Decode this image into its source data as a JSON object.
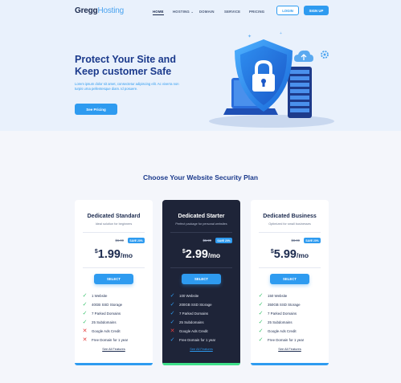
{
  "brand": {
    "bold": "Gregg",
    "light": "Hosting"
  },
  "nav": {
    "home": "HOME",
    "hosting": "HOSTING",
    "hosting_caret": "⌄",
    "domain": "DOMAIN",
    "service": "SERVICE",
    "pricing": "PRICING"
  },
  "auth": {
    "login": "LOGIN",
    "signup": "SIGN UP"
  },
  "hero": {
    "title": "Protect Your Site and Keep customer Safe",
    "text": "Lorem ipsum dolor sit amet, consectetur adipiscing elit. Ac viverra non turpis urna pellentesque diam. Id posuere.",
    "button": "See Pricing"
  },
  "plans_title": "Choose Your Website Security Plan",
  "plans": [
    {
      "name": "Dedicated Standard",
      "tagline": "Ideal solution for beginners",
      "old_price": "$6.99",
      "save": "SAVE 20%",
      "currency": "$",
      "price": "1.99",
      "period": "/mo",
      "select": "SELECT",
      "features": [
        {
          "text": "1 Website",
          "included": true
        },
        {
          "text": "40GB SSD Storage",
          "included": true
        },
        {
          "text": "7 Parked Domains",
          "included": true
        },
        {
          "text": "25 Subdomains",
          "included": true
        },
        {
          "text": "Google Ads Credit",
          "included": false
        },
        {
          "text": "Free Domain for 1 year",
          "included": false
        }
      ],
      "see_all": "See All Features"
    },
    {
      "name": "Dedicated Starter",
      "tagline": "Perfect package for personal websites",
      "old_price": "$6.99",
      "save": "SAVE 20%",
      "currency": "$",
      "price": "2.99",
      "period": "/mo",
      "select": "SELECT",
      "features": [
        {
          "text": "100 Website",
          "included": true
        },
        {
          "text": "200GB SSD Storage",
          "included": true
        },
        {
          "text": "7 Parked Domains",
          "included": true
        },
        {
          "text": "25 Subdomains",
          "included": true
        },
        {
          "text": "Google Ads Credit",
          "included": false
        },
        {
          "text": "Free Domain for 1 year",
          "included": true
        }
      ],
      "see_all": "See All Features"
    },
    {
      "name": "Dedicated Business",
      "tagline": "Optimized for small businesses",
      "old_price": "$8.99",
      "save": "SAVE 20%",
      "currency": "$",
      "price": "5.99",
      "period": "/mo",
      "select": "SELECT",
      "features": [
        {
          "text": "150 Website",
          "included": true
        },
        {
          "text": "350GB SSD Storage",
          "included": true
        },
        {
          "text": "7 Parked Domains",
          "included": true
        },
        {
          "text": "25 Subdomains",
          "included": true
        },
        {
          "text": "Google Ads Credit",
          "included": true
        },
        {
          "text": "Free Domain for 1 year",
          "included": true
        }
      ],
      "see_all": "See All Features"
    }
  ],
  "icons": {
    "check": "check-icon",
    "cross": "cross-icon",
    "illustration": "shield-lock-laptop-server"
  },
  "colors": {
    "primary": "#2e9bf0",
    "navy": "#1b3a8c",
    "dark_card": "#1e2438",
    "accent_green": "#3ee08a",
    "check_green": "#3cc46f",
    "cross_red": "#e53b3b",
    "hero_bg": "#e9f1fc"
  }
}
